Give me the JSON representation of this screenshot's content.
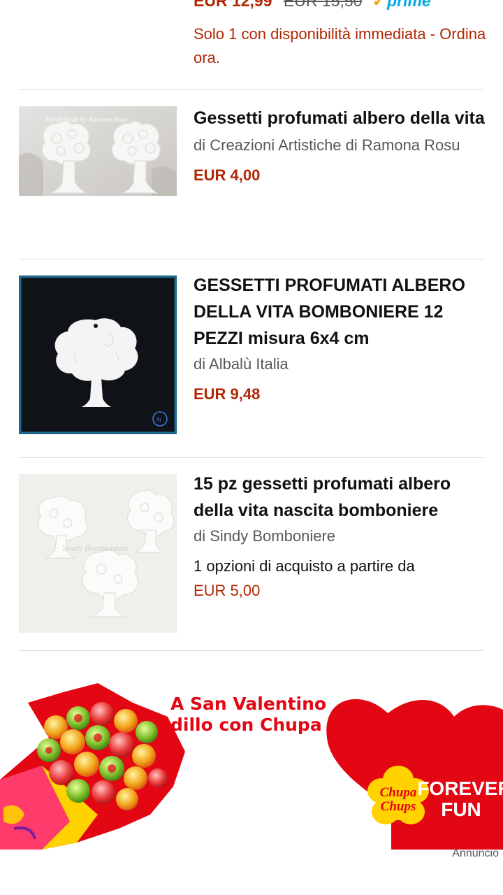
{
  "top_item": {
    "price_now": "EUR 12,99",
    "price_old": "EUR 15,50",
    "prime_label": "prime",
    "availability": "Solo 1 con disponibilità immediata - Ordina ora."
  },
  "products": [
    {
      "title": "Gessetti profumati albero della vita",
      "byline": "di Creazioni Artistiche di Ramona Rosu",
      "price": "EUR 4,00",
      "image_watermark": "Hand Made by Ramona Rosu"
    },
    {
      "title": "GESSETTI PROFUMATI ALBERO DELLA VITA BOMBONIERE 12 PEZZI misura 6x4 cm",
      "byline": "di Albalù Italia",
      "price": "EUR 9,48"
    },
    {
      "title": "15 pz gessetti profumati albero della vita nascita bomboniere",
      "byline": "di Sindy Bomboniere",
      "offers": "1 opzioni di acquisto a partire da",
      "price": "EUR 5,00",
      "image_watermark": "Sindy Bomboniere"
    }
  ],
  "ad": {
    "headline_line1": "A San Valentino",
    "headline_line2": "dillo con Chupa Chups",
    "registered": "®",
    "brand_line1": "Chupa",
    "brand_line2": "Chups",
    "slogan_line1": "FOREVER",
    "slogan_line2": "FUN",
    "label": "Annuncio",
    "colors": {
      "red": "#e30613",
      "yellow": "#ffd200",
      "headline": "#e30613"
    }
  }
}
